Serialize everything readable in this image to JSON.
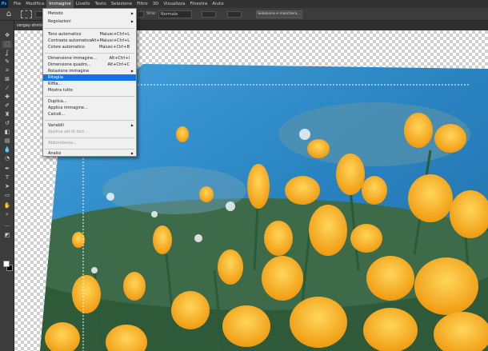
{
  "app": {
    "logo": "Ps"
  },
  "menubar": [
    "File",
    "Modifica",
    "Immagine",
    "Livello",
    "Testo",
    "Selezione",
    "Filtro",
    "3D",
    "Visualizza",
    "Finestra",
    "Aiuto"
  ],
  "options": {
    "style_label": "Stile:",
    "style_value": "Normale",
    "select_mask_label": "Seleziona e maschera..."
  },
  "tab": {
    "title": "sergey-shmidt"
  },
  "image_menu": {
    "items": [
      {
        "label": "Metodo",
        "submenu": true
      },
      {
        "label": "Regolazioni",
        "submenu": true
      },
      {
        "sep": true
      },
      {
        "label": "Tono automatico",
        "shortcut": "Maiusc+Ctrl+L"
      },
      {
        "label": "Contrasto automatico",
        "shortcut": "Alt+Maiusc+Ctrl+L"
      },
      {
        "label": "Colore automatico",
        "shortcut": "Maiusc+Ctrl+B"
      },
      {
        "sep": true
      },
      {
        "label": "Dimensione immagine...",
        "shortcut": "Alt+Ctrl+I"
      },
      {
        "label": "Dimensione quadro...",
        "shortcut": "Alt+Ctrl+C"
      },
      {
        "label": "Rotazione immagine",
        "submenu": true
      },
      {
        "label": "Ritaglia",
        "highlighted": true
      },
      {
        "label": "Rifila..."
      },
      {
        "label": "Mostra tutto"
      },
      {
        "sep": true
      },
      {
        "label": "Duplica..."
      },
      {
        "label": "Applica immagine..."
      },
      {
        "label": "Calcoli..."
      },
      {
        "sep": true
      },
      {
        "label": "Variabili",
        "submenu": true
      },
      {
        "label": "Applica set di dati...",
        "disabled": true
      },
      {
        "sep": true
      },
      {
        "label": "Abbondanza...",
        "disabled": true
      },
      {
        "sep": true
      },
      {
        "label": "Analisi",
        "submenu": true
      }
    ]
  },
  "toolbar": {
    "tools": [
      "move-icon",
      "marquee-icon",
      "lasso-icon",
      "quick-select-icon",
      "crop-icon",
      "frame-icon",
      "eyedropper-icon",
      "healing-icon",
      "brush-icon",
      "clone-stamp-icon",
      "history-brush-icon",
      "eraser-icon",
      "gradient-icon",
      "blur-icon",
      "dodge-icon",
      "pen-icon",
      "type-icon",
      "path-select-icon",
      "shape-icon",
      "hand-icon",
      "zoom-icon",
      "more-icon"
    ]
  },
  "colors": {
    "accent": "#1473e6",
    "sky": "#2b86c4",
    "petal": "#f5a81a",
    "stem": "#2f5a3a"
  }
}
